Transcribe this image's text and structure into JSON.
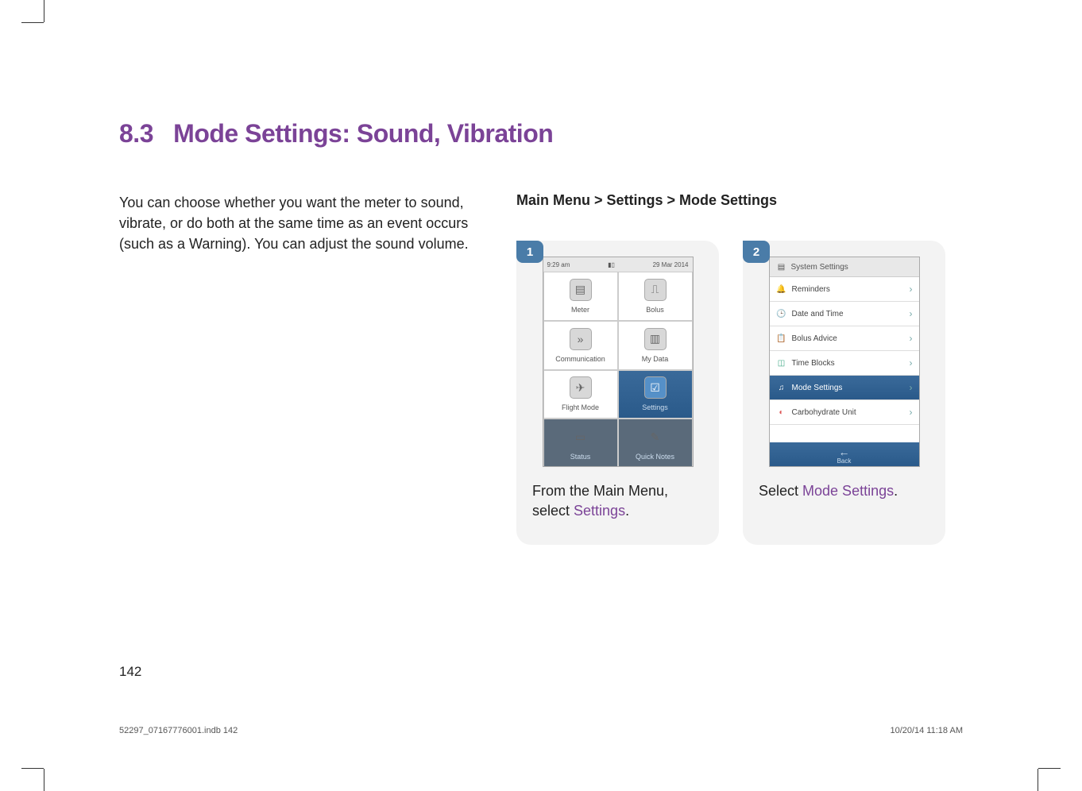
{
  "section": {
    "number": "8.3",
    "title": "Mode Settings: Sound, Vibration"
  },
  "intro": "You can choose whether you want the meter to sound, vibrate, or do both at the same time as an event occurs (such as a Warning). You can adjust the sound volume.",
  "breadcrumb": "Main Menu > Settings > Mode Settings",
  "steps": [
    {
      "badge": "1",
      "screen": {
        "statusbar": {
          "time": "9:29 am",
          "date": "29 Mar 2014"
        },
        "grid": [
          {
            "label": "Meter",
            "icon": "▤"
          },
          {
            "label": "Bolus",
            "icon": "⎍"
          },
          {
            "label": "Communication",
            "icon": "»"
          },
          {
            "label": "My Data",
            "icon": "▥"
          },
          {
            "label": "Flight Mode",
            "icon": "✈"
          },
          {
            "label": "Settings",
            "icon": "☑",
            "selected": true
          },
          {
            "label": "Status",
            "icon": "▭",
            "dark": true
          },
          {
            "label": "Quick Notes",
            "icon": "✎",
            "dark": true
          }
        ]
      },
      "caption_prefix": "From the Main Menu, select ",
      "caption_highlight": "Settings",
      "caption_suffix": "."
    },
    {
      "badge": "2",
      "screen": {
        "header": "System Settings",
        "list": [
          {
            "label": "Reminders",
            "icon": "🔔",
            "iconColor": "#e5a83a"
          },
          {
            "label": "Date and Time",
            "icon": "🕒",
            "iconColor": "#888"
          },
          {
            "label": "Bolus Advice",
            "icon": "📋",
            "iconColor": "#c55"
          },
          {
            "label": "Time Blocks",
            "icon": "◫",
            "iconColor": "#4a8"
          },
          {
            "label": "Mode Settings",
            "icon": "♫",
            "iconColor": "#fff",
            "selected": true
          },
          {
            "label": "Carbohydrate Unit",
            "icon": "◐",
            "iconColor": "#d55"
          }
        ],
        "back": "Back"
      },
      "caption_prefix": "Select ",
      "caption_highlight": "Mode Settings",
      "caption_suffix": "."
    }
  ],
  "pageNumber": "142",
  "footer": {
    "filename": "52297_07167776001.indb   142",
    "datetime": "10/20/14   11:18 AM"
  }
}
